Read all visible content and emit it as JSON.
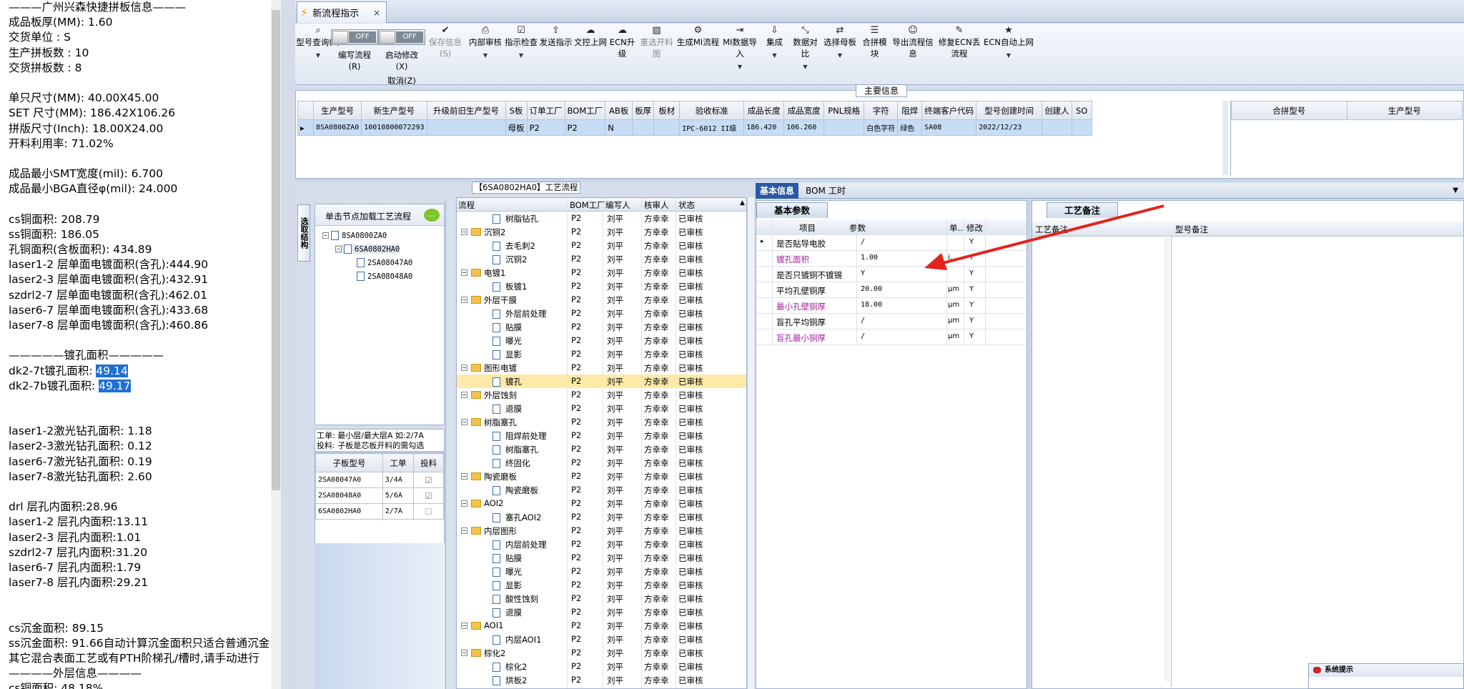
{
  "left_panel": {
    "lines": [
      "———广州兴森快捷拼板信息———",
      "成品板厚(MM): 1.60",
      "交货单位 : S",
      "生产拼板数 : 10",
      "交货拼板数 : 8",
      "",
      "单只尺寸(MM): 40.00X45.00",
      "SET 尺寸(MM): 186.42X106.26",
      "拼版尺寸(Inch): 18.00X24.00",
      "开料利用率: 71.02%",
      "",
      "成品最小SMT宽度(mil): 6.700",
      "成品最小BGA直径φ(mil):   24.000",
      "",
      "cs铜面积: 208.79",
      "ss铜面积: 186.05",
      "孔铜面积(含板面积): 434.89",
      "laser1-2       层单面电镀面积(含孔):444.90",
      "laser2-3       层单面电镀面积(含孔):432.91",
      "szdrl2-7       层单面电镀面积(含孔):462.01",
      "laser6-7       层单面电镀面积(含孔):433.68",
      "laser7-8       层单面电镀面积(含孔):460.86",
      "",
      "—————镀孔面积—————",
      "dk2-7t镀孔面积: 49.14",
      "dk2-7b镀孔面积: 49.17",
      "",
      "",
      "laser1-2激光钻孔面积: 1.18",
      "laser2-3激光钻孔面积: 0.12",
      "laser6-7激光钻孔面积: 0.19",
      "laser7-8激光钻孔面积: 2.60",
      "",
      "drl            层孔内面积:28.96",
      "laser1-2       层孔内面积:13.11",
      "laser2-3       层孔内面积:1.01",
      "szdrl2-7       层孔内面积:31.20",
      "laser6-7       层孔内面积:1.79",
      "laser7-8       层孔内面积:29.21",
      "",
      "",
      "cs沉金面积: 89.15",
      "ss沉金面积: 91.66自动计算沉金面积只适合普通沉金",
      "其它混合表面工艺或有PTH阶梯孔/槽时,请手动进行",
      "————外层信息————",
      "cs铜面积: 48.18%"
    ]
  },
  "tab": {
    "title": "新流程指示",
    "close": "×"
  },
  "toolbar": [
    {
      "label": "型号查询(F)",
      "icon": "search-icon",
      "glyph": "⌕",
      "dd": true,
      "disabled": false
    },
    {
      "label": "编写流程(R)",
      "toggle": "OFF"
    },
    {
      "label": "启动修改(X)",
      "label2": "取消(Z)",
      "toggle": "OFF"
    },
    {
      "label": "保存信息(S)",
      "icon": "check-icon",
      "glyph": "✔",
      "dd": false,
      "disabled": true
    },
    {
      "label": "内部审核",
      "icon": "printer-icon",
      "glyph": "⎙",
      "dd": true,
      "disabled": false
    },
    {
      "label": "指示检查",
      "icon": "checkbox-icon",
      "glyph": "☑",
      "dd": true,
      "disabled": false
    },
    {
      "label": "发送指示",
      "icon": "upload-icon",
      "glyph": "⇪",
      "dd": false,
      "disabled": false
    },
    {
      "label": "文控上网",
      "icon": "cloud-upload-icon",
      "glyph": "☁",
      "dd": false,
      "disabled": false
    },
    {
      "label": "ECN升级",
      "icon": "cloud-icon",
      "glyph": "☁",
      "dd": false,
      "disabled": false
    },
    {
      "label": "重选开料图",
      "icon": "image-icon",
      "glyph": "▨",
      "dd": false,
      "disabled": true
    },
    {
      "label": "生成MI流程",
      "icon": "gears-icon",
      "glyph": "⚙",
      "dd": false,
      "disabled": false
    },
    {
      "label": "MI数据导入",
      "icon": "import-icon",
      "glyph": "⇥",
      "dd": true,
      "disabled": false
    },
    {
      "label": "集成",
      "icon": "download-icon",
      "glyph": "⇩",
      "dd": true,
      "disabled": false
    },
    {
      "label": "数据对比",
      "icon": "compare-icon",
      "glyph": "⤡",
      "dd": true,
      "disabled": false
    },
    {
      "label": "选择母板",
      "icon": "shuffle-icon",
      "glyph": "⇄",
      "dd": true,
      "disabled": false
    },
    {
      "label": "合拼模块",
      "icon": "list-icon",
      "glyph": "☰",
      "dd": false,
      "disabled": false
    },
    {
      "label": "导出流程信息",
      "icon": "smile-icon",
      "glyph": "☺",
      "dd": false,
      "disabled": false
    },
    {
      "label": "修复ECN丢流程",
      "icon": "wrench-icon",
      "glyph": "✎",
      "dd": false,
      "disabled": false
    },
    {
      "label": "ECN自动上网",
      "icon": "star-icon",
      "glyph": "★",
      "dd": true,
      "disabled": false
    }
  ],
  "main_info": {
    "title": "主要信息",
    "headers": [
      "生产型号",
      "新生产型号",
      "升级前旧生产型号",
      "S板",
      "订单工厂",
      "BOM工厂",
      "AB板",
      "板厚",
      "板材",
      "验收标准",
      "成品长度",
      "成品宽度",
      "PNL规格",
      "字符",
      "阻焊",
      "终端客户代码",
      "型号创建时间",
      "创建人",
      "SO"
    ],
    "row": [
      "8SA0800ZA0",
      "10010800072293",
      "",
      "母板",
      "P2",
      "P2",
      "N",
      "",
      "",
      "IPC-6012 II级",
      "186.420",
      "106.260",
      "",
      "白色字符",
      "绿色",
      "SA08",
      "2022/12/23",
      "",
      ""
    ],
    "right_headers": [
      "合拼型号",
      "生产型号"
    ]
  },
  "left_nav": {
    "vtab": "选取结构",
    "tree_header": "单击节点加载工艺流程",
    "tree": [
      "8SA0800ZA0",
      "6SA0802HA0",
      "2SA08047A0",
      "2SA08048A0"
    ],
    "info1": "工单: 最小层/最大层A 如:2/7A",
    "info2": "投料: 子板是芯板开料的需勾选",
    "sub_headers": [
      "子板型号",
      "工单",
      "投料"
    ],
    "sub_rows": [
      {
        "model": "2SA08047A0",
        "order": "3/4A",
        "feed": true
      },
      {
        "model": "2SA08048A0",
        "order": "5/6A",
        "feed": true
      },
      {
        "model": "6SA0802HA0",
        "order": "2/7A",
        "feed": false
      }
    ]
  },
  "process": {
    "title": "【6SA0802HA0】工艺流程",
    "headers": [
      "流程",
      "BOM工厂",
      "编写人",
      "核审人",
      "状态"
    ],
    "rows": [
      {
        "lv": 2,
        "t": "doc",
        "name": "树脂钻孔"
      },
      {
        "lv": 1,
        "t": "fold",
        "name": "沉铜2"
      },
      {
        "lv": 2,
        "t": "doc",
        "name": "去毛刺2"
      },
      {
        "lv": 2,
        "t": "doc",
        "name": "沉铜2"
      },
      {
        "lv": 1,
        "t": "fold",
        "name": "电镀1"
      },
      {
        "lv": 2,
        "t": "doc",
        "name": "板镀1"
      },
      {
        "lv": 1,
        "t": "fold",
        "name": "外层干膜"
      },
      {
        "lv": 2,
        "t": "doc",
        "name": "外层前处理"
      },
      {
        "lv": 2,
        "t": "doc",
        "name": "贴膜"
      },
      {
        "lv": 2,
        "t": "doc",
        "name": "曝光"
      },
      {
        "lv": 2,
        "t": "doc",
        "name": "显影"
      },
      {
        "lv": 1,
        "t": "fold",
        "name": "图形电镀"
      },
      {
        "lv": 2,
        "t": "doc",
        "name": "镀孔",
        "sel": true
      },
      {
        "lv": 1,
        "t": "fold",
        "name": "外层蚀刻"
      },
      {
        "lv": 2,
        "t": "doc",
        "name": "退膜"
      },
      {
        "lv": 1,
        "t": "fold",
        "name": "树脂塞孔"
      },
      {
        "lv": 2,
        "t": "doc",
        "name": "阻焊前处理"
      },
      {
        "lv": 2,
        "t": "doc",
        "name": "树脂塞孔"
      },
      {
        "lv": 2,
        "t": "doc",
        "name": "终固化"
      },
      {
        "lv": 1,
        "t": "fold",
        "name": "陶瓷磨板"
      },
      {
        "lv": 2,
        "t": "doc",
        "name": "陶瓷磨板"
      },
      {
        "lv": 1,
        "t": "fold",
        "name": "AOI2"
      },
      {
        "lv": 2,
        "t": "doc",
        "name": "塞孔AOI2"
      },
      {
        "lv": 1,
        "t": "fold",
        "name": "内层图形"
      },
      {
        "lv": 2,
        "t": "doc",
        "name": "内层前处理"
      },
      {
        "lv": 2,
        "t": "doc",
        "name": "贴膜"
      },
      {
        "lv": 2,
        "t": "doc",
        "name": "曝光"
      },
      {
        "lv": 2,
        "t": "doc",
        "name": "显影"
      },
      {
        "lv": 2,
        "t": "doc",
        "name": "酸性蚀刻"
      },
      {
        "lv": 2,
        "t": "doc",
        "name": "退膜"
      },
      {
        "lv": 1,
        "t": "fold",
        "name": "AOI1"
      },
      {
        "lv": 2,
        "t": "doc",
        "name": "内层AOI1"
      },
      {
        "lv": 1,
        "t": "fold",
        "name": "棕化2"
      },
      {
        "lv": 2,
        "t": "doc",
        "name": "棕化2"
      },
      {
        "lv": 2,
        "t": "doc",
        "name": "烘板2"
      }
    ],
    "bom": "P2",
    "writer": "刘平",
    "reviewer": "方幸幸",
    "status": "已审核"
  },
  "right": {
    "tabs": [
      "基本信息",
      "BOM",
      "工时"
    ],
    "basic_title": "基本参数",
    "basic_headers": [
      "项目",
      "参数",
      "单...",
      "修改"
    ],
    "basic_rows": [
      {
        "item": "是否贴导电胶",
        "param": "/",
        "unit": "",
        "mod": "Y",
        "purple": false
      },
      {
        "item": "镀孔面积",
        "param": "1.00",
        "unit": "i...",
        "mod": "Y",
        "purple": true
      },
      {
        "item": "是否只镀铜不镀锡",
        "param": "Y",
        "unit": "",
        "mod": "Y",
        "purple": false
      },
      {
        "item": "平均孔壁铜厚",
        "param": "20.00",
        "unit": "μm",
        "mod": "Y",
        "purple": false
      },
      {
        "item": "最小孔壁铜厚",
        "param": "18.00",
        "unit": "μm",
        "mod": "Y",
        "purple": true
      },
      {
        "item": "盲孔平均铜厚",
        "param": "/",
        "unit": "μm",
        "mod": "Y",
        "purple": false
      },
      {
        "item": "盲孔最小铜厚",
        "param": "/",
        "unit": "μm",
        "mod": "Y",
        "purple": true
      }
    ],
    "craft_title": "工艺备注",
    "craft_cols": [
      "工艺备注",
      "型号备注"
    ]
  },
  "sysmsg": "系统提示",
  "colors": {
    "highlight": "#1f6fd1",
    "arrow": "#e3231c",
    "purple": "#a0269c",
    "selected_row": "#fdeaa8"
  }
}
